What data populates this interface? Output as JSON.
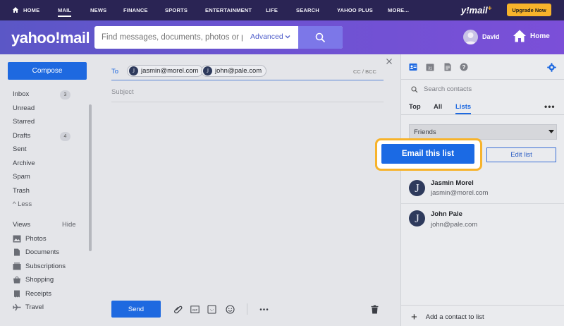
{
  "topnav": {
    "items": [
      "HOME",
      "MAIL",
      "NEWS",
      "FINANCE",
      "SPORTS",
      "ENTERTAINMENT",
      "LIFE",
      "SEARCH",
      "YAHOO PLUS",
      "MORE..."
    ],
    "active": "MAIL",
    "brand": "y!mail",
    "brand_plus": "+",
    "upgrade_label": "Upgrade Now"
  },
  "header": {
    "logo": "yahoo!mail",
    "search_placeholder": "Find messages, documents, photos or peo|",
    "advanced_label": "Advanced",
    "user_name": "David",
    "home_label": "Home"
  },
  "sidebar": {
    "compose_label": "Compose",
    "folders": [
      {
        "label": "Inbox",
        "count": "3"
      },
      {
        "label": "Unread",
        "count": ""
      },
      {
        "label": "Starred",
        "count": ""
      },
      {
        "label": "Drafts",
        "count": "4"
      },
      {
        "label": "Sent",
        "count": ""
      },
      {
        "label": "Archive",
        "count": ""
      },
      {
        "label": "Spam",
        "count": ""
      },
      {
        "label": "Trash",
        "count": ""
      }
    ],
    "less_label": "^ Less",
    "views_label": "Views",
    "hide_label": "Hide",
    "views": [
      "Photos",
      "Documents",
      "Subscriptions",
      "Shopping",
      "Receipts",
      "Travel"
    ]
  },
  "compose": {
    "to_label": "To",
    "recipients": [
      {
        "initial": "J",
        "email": "jasmin@morel.com"
      },
      {
        "initial": "J",
        "email": "john@pale.com"
      }
    ],
    "cc_bcc": "CC / BCC",
    "subject_placeholder": "Subject",
    "send_label": "Send"
  },
  "contacts": {
    "search_placeholder": "Search contacts",
    "tabs": [
      "Top",
      "All",
      "Lists"
    ],
    "active_tab": "Lists",
    "selected_list": "Friends",
    "email_list_label": "Email this list",
    "edit_list_label": "Edit list",
    "members": [
      {
        "initial": "J",
        "name": "Jasmin Morel",
        "email": "jasmin@morel.com"
      },
      {
        "initial": "J",
        "name": "John Pale",
        "email": "john@pale.com"
      }
    ],
    "add_label": "Add a contact to list"
  },
  "colors": {
    "accent": "#1e69e0",
    "highlight": "#f7b32b",
    "nav_bg": "#2a2454",
    "header_bg": "#6a53d0"
  }
}
